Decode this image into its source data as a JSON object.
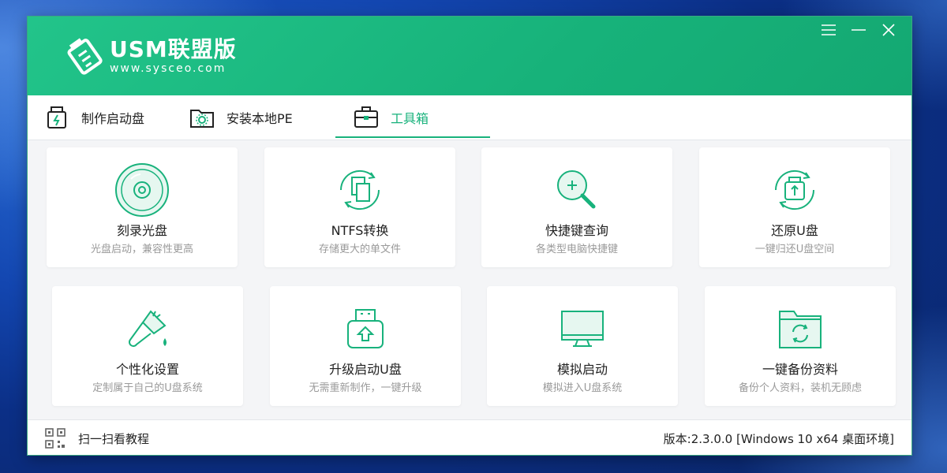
{
  "app": {
    "title": "USM联盟版",
    "url": "www.sysceo.com"
  },
  "colors": {
    "brand": "#18b27c",
    "header_bg": "#1fbd84"
  },
  "window_controls": {
    "menu_icon": "menu-icon",
    "minimize_icon": "minimize-icon",
    "close_icon": "close-icon"
  },
  "tabs": [
    {
      "label": "制作启动盘",
      "icon": "usb-flash-icon"
    },
    {
      "label": "安装本地PE",
      "icon": "folder-gear-icon"
    },
    {
      "label": "工具箱",
      "icon": "toolbox-icon",
      "active": true
    }
  ],
  "tools": [
    {
      "title": "刻录光盘",
      "subtitle": "光盘启动，兼容性更高",
      "icon": "disc-icon"
    },
    {
      "title": "NTFS转换",
      "subtitle": "存储更大的单文件",
      "icon": "file-convert-icon"
    },
    {
      "title": "快捷键查询",
      "subtitle": "各类型电脑快捷键",
      "icon": "magnifier-icon"
    },
    {
      "title": "还原U盘",
      "subtitle": "一键归还U盘空间",
      "icon": "usb-restore-icon"
    },
    {
      "title": "个性化设置",
      "subtitle": "定制属于自己的U盘系统",
      "icon": "paint-brush-icon"
    },
    {
      "title": "升级启动U盘",
      "subtitle": "无需重新制作，一键升级",
      "icon": "usb-upgrade-icon"
    },
    {
      "title": "模拟启动",
      "subtitle": "模拟进入U盘系统",
      "icon": "monitor-icon"
    },
    {
      "title": "一键备份资料",
      "subtitle": "备份个人资料，装机无顾虑",
      "icon": "folder-sync-icon"
    }
  ],
  "footer": {
    "qr_label": "扫一扫看教程",
    "version": "版本:2.3.0.0 [Windows 10 x64 桌面环境]"
  }
}
